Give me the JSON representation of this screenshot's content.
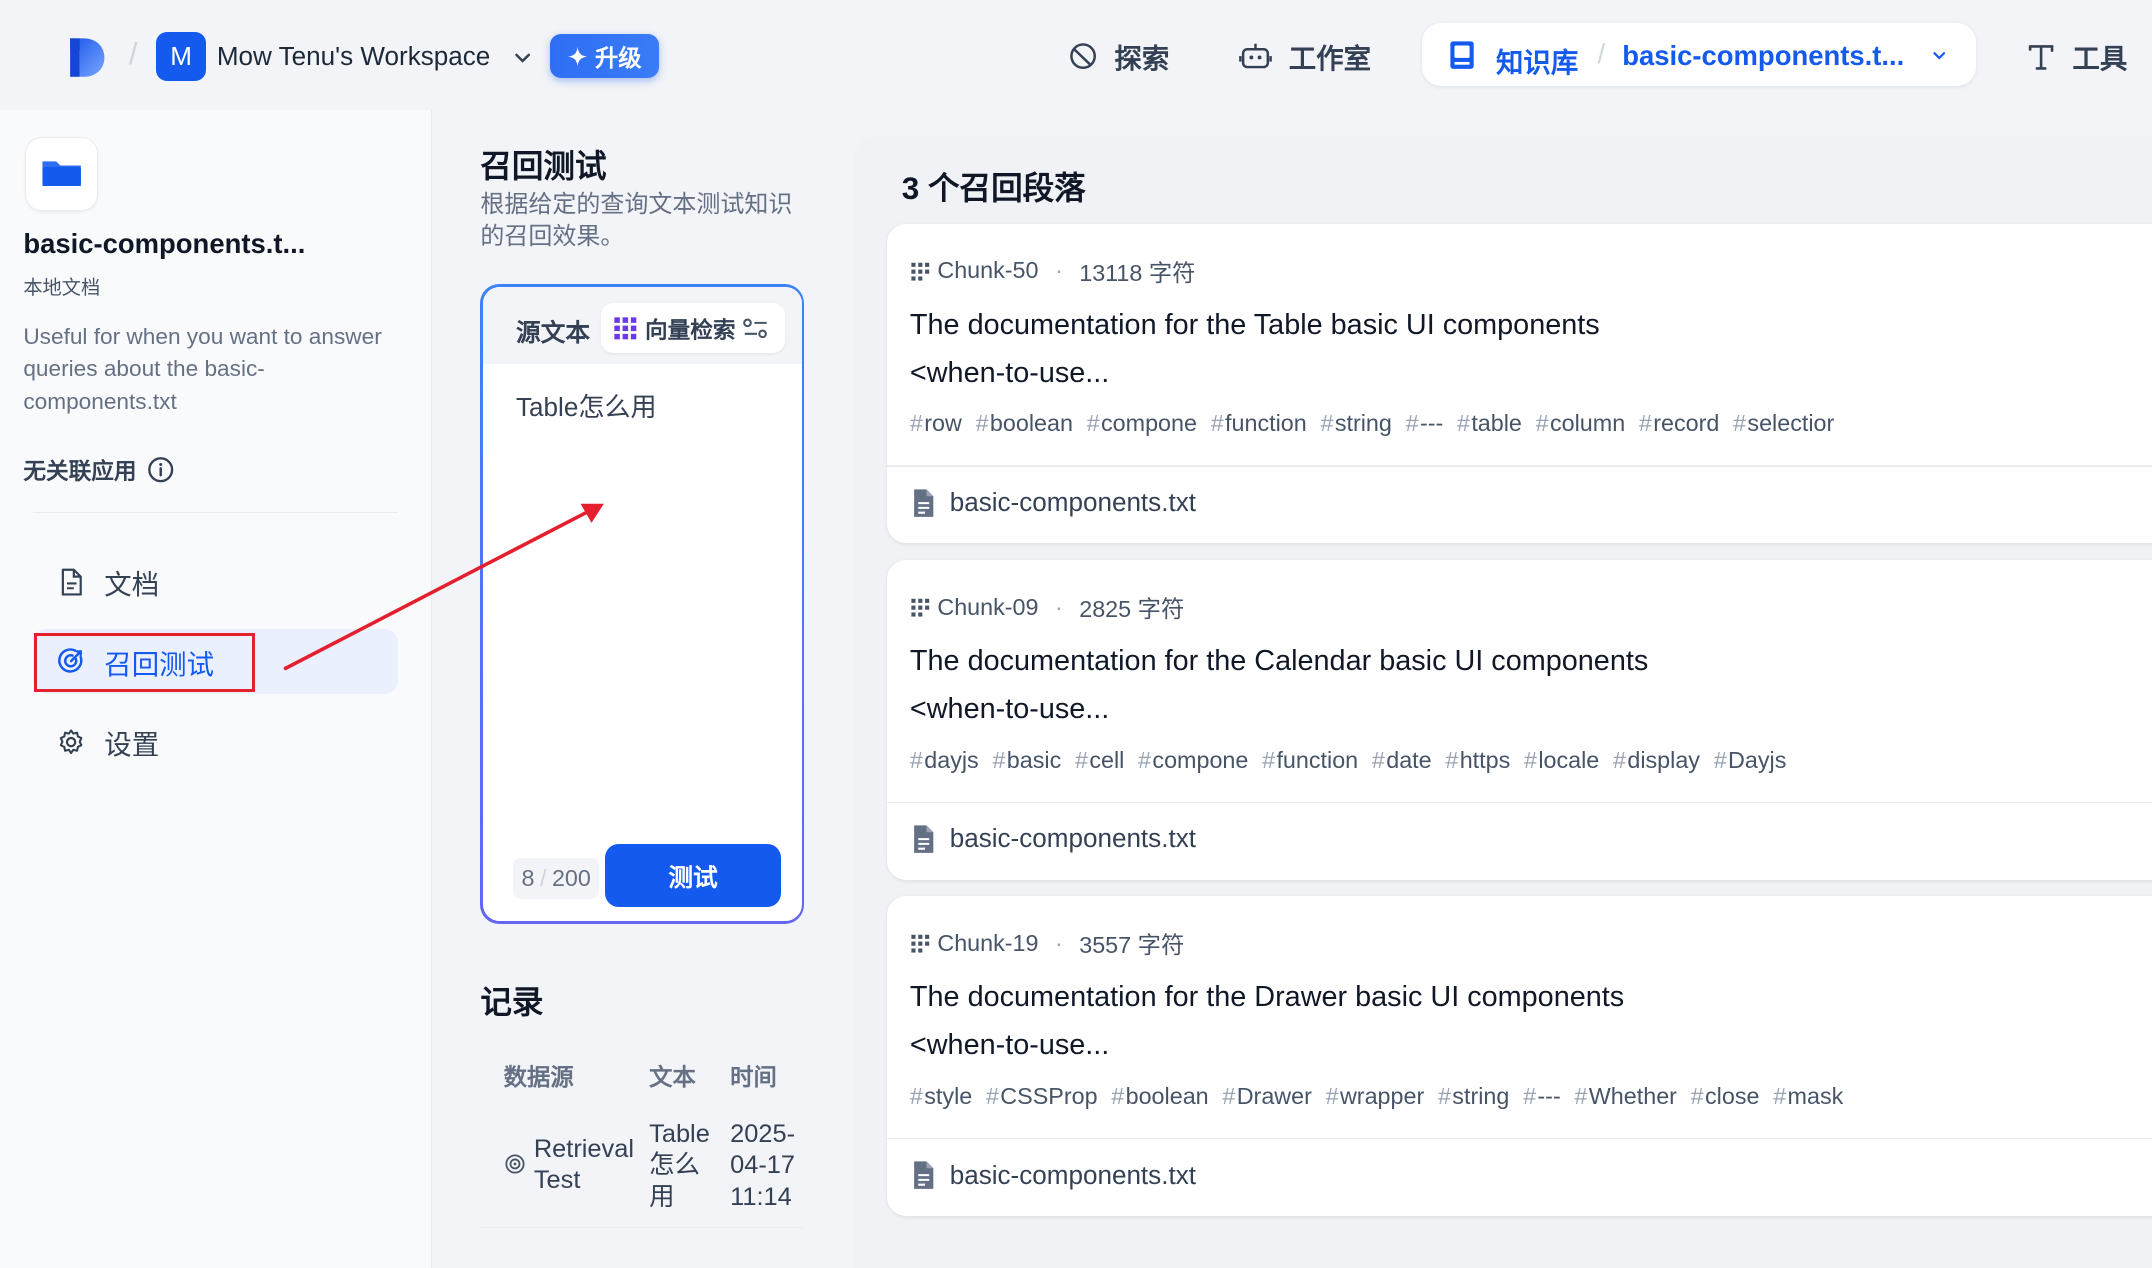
{
  "header": {
    "workspace_initial": "M",
    "workspace_name": "Mow Tenu's Workspace",
    "upgrade_label": "升级",
    "nav": {
      "explore": "探索",
      "studio": "工作室",
      "knowledge": "知识库",
      "knowledge_separator": "/",
      "dataset_breadcrumb": "basic-components.t...",
      "tools": "工具"
    },
    "separator": "/"
  },
  "sidebar": {
    "dataset_title": "basic-components.t...",
    "dataset_type": "本地文档",
    "description": "Useful for when you want to answer queries about the basic-components.txt",
    "no_linked_apps": "无关联应用",
    "items": [
      {
        "label": "文档",
        "icon": "document-icon",
        "active": false
      },
      {
        "label": "召回测试",
        "icon": "target-icon",
        "active": true
      },
      {
        "label": "设置",
        "icon": "gear-icon",
        "active": false
      }
    ]
  },
  "retrieval_test": {
    "title": "召回测试",
    "subtitle": "根据给定的查询文本测试知识的召回效果。",
    "source_text_label": "源文本",
    "mode_label": "向量检索",
    "query_text": "Table怎么用",
    "char_count": "8",
    "char_limit": "200",
    "test_button": "测试"
  },
  "records": {
    "title": "记录",
    "columns": [
      "数据源",
      "文本",
      "时间"
    ],
    "rows": [
      {
        "source": "Retrieval Test",
        "text": "Table怎么用",
        "time": "2025-04-17 11:14"
      }
    ]
  },
  "results": {
    "title": "3 个召回段落",
    "chunks": [
      {
        "id": "Chunk-50",
        "chars": "13118 字符",
        "line1": "The documentation for the Table basic UI components",
        "line2": "<when-to-use...",
        "tags": [
          "row",
          "boolean",
          "compone",
          "function",
          "string",
          "---",
          "table",
          "column",
          "record",
          "selectior"
        ],
        "file": "basic-components.txt"
      },
      {
        "id": "Chunk-09",
        "chars": "2825 字符",
        "line1": "The documentation for the Calendar basic UI components",
        "line2": "<when-to-use...",
        "tags": [
          "dayjs",
          "basic",
          "cell",
          "compone",
          "function",
          "date",
          "https",
          "locale",
          "display",
          "Dayjs"
        ],
        "file": "basic-components.txt"
      },
      {
        "id": "Chunk-19",
        "chars": "3557 字符",
        "line1": "The documentation for the Drawer basic UI components",
        "line2": "<when-to-use...",
        "tags": [
          "style",
          "CSSProp",
          "boolean",
          "Drawer",
          "wrapper",
          "string",
          "---",
          "Whether",
          "close",
          "mask"
        ],
        "file": "basic-components.txt"
      }
    ]
  },
  "colors": {
    "accent": "#155aef",
    "annotation": "#e4202e",
    "background": "#f2f4f7"
  }
}
